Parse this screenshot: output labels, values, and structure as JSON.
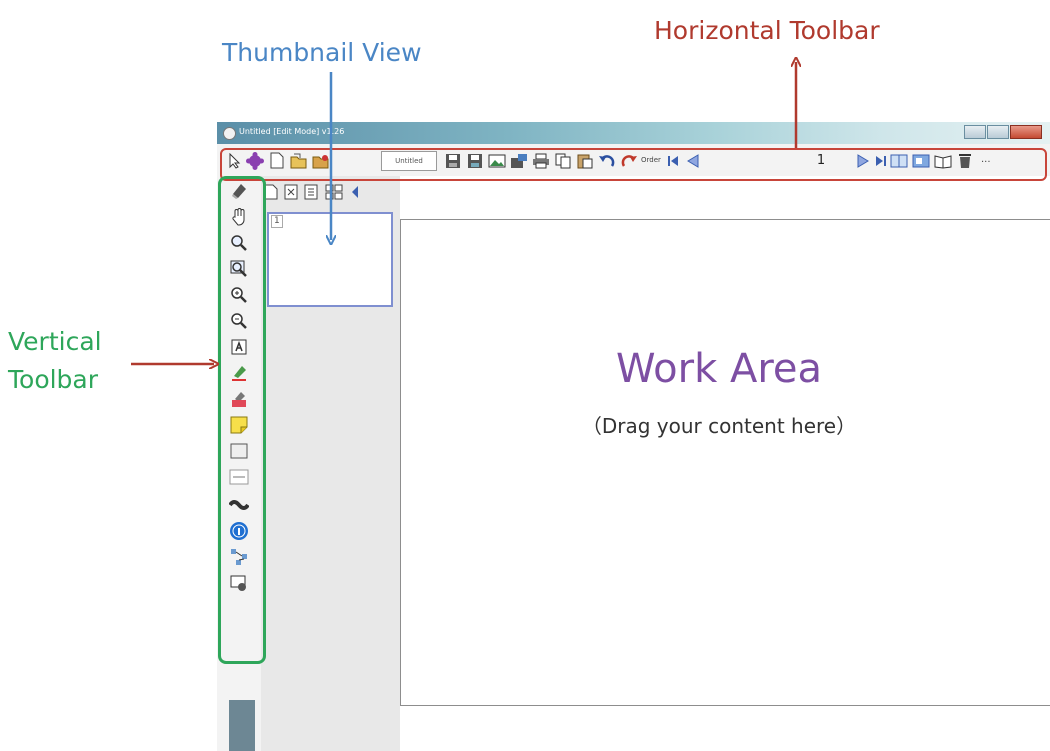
{
  "annotations": {
    "thumbnail_view": "Thumbnail View",
    "horizontal_toolbar": "Horizontal Toolbar",
    "vertical_toolbar_line1": "Vertical",
    "vertical_toolbar_line2": "Toolbar"
  },
  "window": {
    "title": "Untitled [Edit Mode] v1.26"
  },
  "horizontal_toolbar": {
    "document_tab": "Untitled",
    "order_label": "Order",
    "page_number": "1",
    "overflow": "..."
  },
  "thumbnail": {
    "page_label": "1"
  },
  "work_area": {
    "title": "Work Area",
    "subtitle": "（Drag your content here）"
  },
  "icons": {
    "horizontal": [
      "select-arrow-icon",
      "puzzle-icon",
      "new-page-icon",
      "open-icon",
      "open-folder-icon",
      "save-icon",
      "save-as-icon",
      "image-icon",
      "export-icon",
      "print-icon",
      "copy-icon",
      "paste-icon",
      "undo-icon",
      "redo-icon",
      "first-page-icon",
      "prev-page-icon",
      "next-page-icon",
      "last-page-icon",
      "single-page-view-icon",
      "dual-page-view-icon",
      "book-view-icon",
      "delete-icon"
    ],
    "vertical": [
      "eraser-icon",
      "hand-icon",
      "zoom-icon",
      "zoom-window-icon",
      "zoom-in-icon",
      "zoom-out-icon",
      "text-icon",
      "highlighter-icon",
      "marker-icon",
      "sticky-note-icon",
      "rectangle-icon",
      "caption-icon",
      "ribbon-icon",
      "info-icon",
      "connector-icon",
      "screen-capture-icon"
    ]
  },
  "colors": {
    "thumbnail_annotation": "#4a86c5",
    "horizontal_annotation": "#b03a2e",
    "vertical_annotation": "#2ea65a",
    "work_area_title": "#7d4fa3"
  }
}
